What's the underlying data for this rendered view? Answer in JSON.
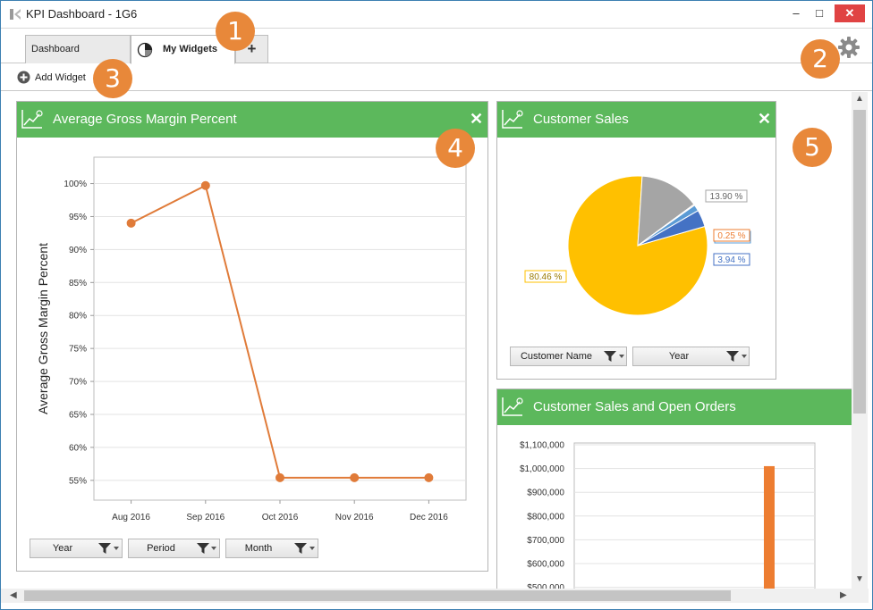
{
  "window": {
    "title": "KPI Dashboard - 1G6",
    "minimize_glyph": "–",
    "maximize_glyph": "□",
    "close_glyph": "✕"
  },
  "tabs": {
    "dashboard_label": "Dashboard",
    "widgets_label": "My Widgets",
    "add_label": "+"
  },
  "toolbar": {
    "add_widget_label": "Add Widget"
  },
  "callouts": [
    "1",
    "2",
    "3",
    "4",
    "5"
  ],
  "widgets": {
    "margin": {
      "title": "Average Gross Margin Percent",
      "close_glyph": "✕",
      "filters": [
        "Year",
        "Period",
        "Month"
      ]
    },
    "sales": {
      "title": "Customer Sales",
      "close_glyph": "✕",
      "filters": [
        "Customer Name",
        "Year"
      ]
    },
    "open_orders": {
      "title": "Customer Sales and Open Orders"
    }
  },
  "colors": {
    "header_green": "#5cb85c",
    "accent_orange": "#e8883a",
    "line_orange": "#e07b39",
    "pie_yellow": "#ffc000",
    "pie_gray": "#a5a5a5",
    "pie_blue": "#4472c4",
    "close_red": "#e04343"
  },
  "chart_data": [
    {
      "type": "line",
      "title": "",
      "ylabel": "Average Gross Margin Percent",
      "xlabel": "",
      "categories": [
        "Aug 2016",
        "Sep 2016",
        "Oct 2016",
        "Nov 2016",
        "Dec 2016"
      ],
      "values": [
        94,
        99.7,
        55.4,
        55.4,
        55.4
      ],
      "y_ticks": [
        "55%",
        "60%",
        "65%",
        "70%",
        "75%",
        "80%",
        "85%",
        "90%",
        "95%",
        "100%"
      ],
      "ylim": [
        52,
        104
      ],
      "grid": true
    },
    {
      "type": "pie",
      "title": "",
      "slices": [
        {
          "label": "80.46 %",
          "value": 80.46,
          "color": "#ffc000"
        },
        {
          "label": "13.90 %",
          "value": 13.9,
          "color": "#a5a5a5"
        },
        {
          "label": "0.25 %",
          "value": 0.25,
          "color": "#ed7d31"
        },
        {
          "label": "1.45 %",
          "value": 1.45,
          "color": "#5b9bd5"
        },
        {
          "label": "3.94 %",
          "value": 3.94,
          "color": "#4472c4"
        }
      ]
    },
    {
      "type": "bar",
      "title": "",
      "y_ticks": [
        "$500,000",
        "$600,000",
        "$700,000",
        "$800,000",
        "$900,000",
        "$1,000,000",
        "$1,100,000"
      ],
      "ylim": [
        460000,
        1100000
      ],
      "grid": true,
      "values": [
        1010000
      ],
      "color": "#ed7d31"
    }
  ]
}
